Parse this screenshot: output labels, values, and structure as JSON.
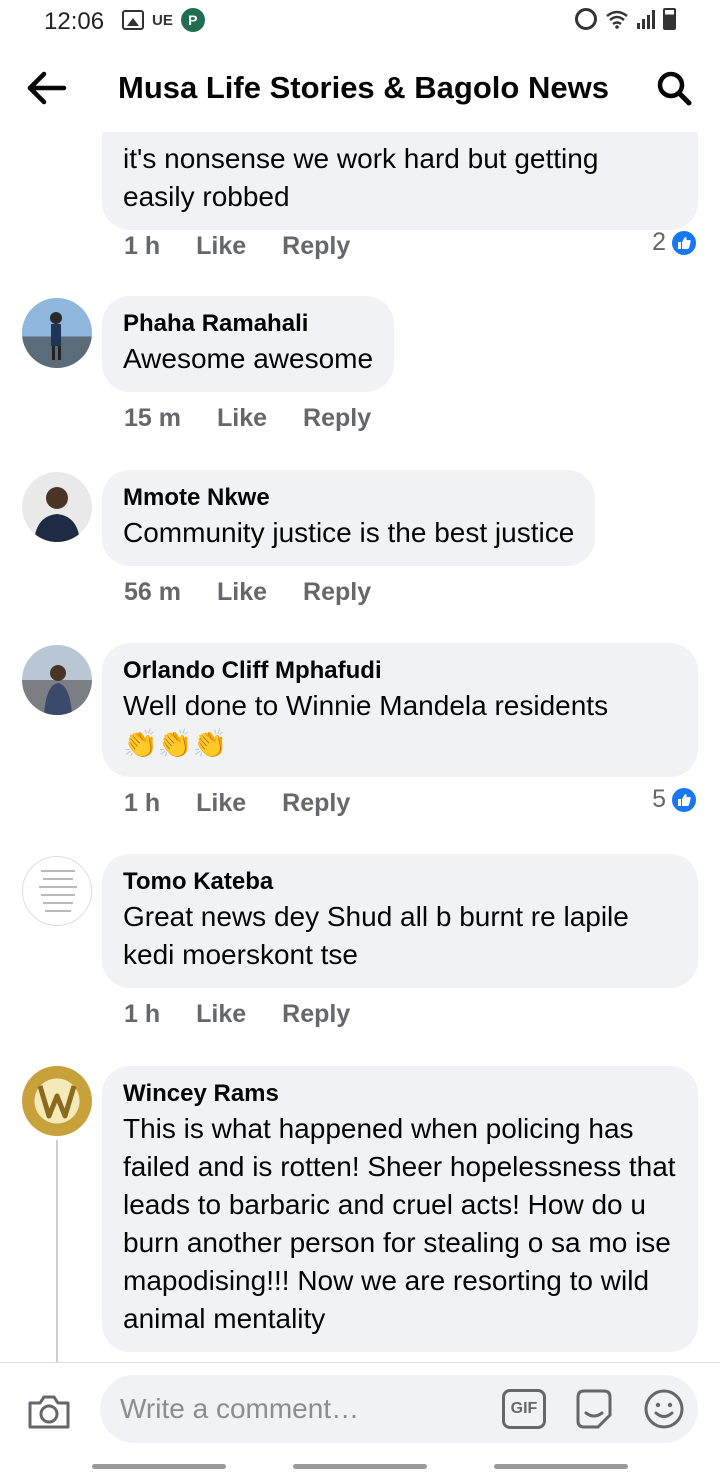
{
  "status_bar": {
    "time": "12:06",
    "carrier": "UE",
    "app_letter": "P"
  },
  "header": {
    "title": "Musa Life Stories & Bagolo News"
  },
  "comments": [
    {
      "author": "",
      "text": "it's nonsense we work hard but getting easily robbed",
      "time": "1 h",
      "like_label": "Like",
      "reply_label": "Reply",
      "reaction_count": "2"
    },
    {
      "author": "Phaha Ramahali",
      "text": "Awesome awesome",
      "time": "15 m",
      "like_label": "Like",
      "reply_label": "Reply",
      "reaction_count": ""
    },
    {
      "author": "Mmote Nkwe",
      "text": "Community justice is the best justice",
      "time": "56 m",
      "like_label": "Like",
      "reply_label": "Reply",
      "reaction_count": ""
    },
    {
      "author": "Orlando Cliff Mphafudi",
      "text": "Well done to Winnie Mandela residents",
      "emoji": "👏👏👏",
      "time": "1 h",
      "like_label": "Like",
      "reply_label": "Reply",
      "reaction_count": "5"
    },
    {
      "author": "Tomo Kateba",
      "text": "Great news dey Shud all b burnt re lapile kedi moerskont tse",
      "time": "1 h",
      "like_label": "Like",
      "reply_label": "Reply",
      "reaction_count": ""
    },
    {
      "author": "Wincey Rams",
      "text": "This is what happened when policing has failed and is rotten! Sheer hopelessness that leads to barbaric and cruel acts! How do u burn another person for stealing o sa mo ise mapodising!!! Now we are resorting to wild animal mentality",
      "time": "",
      "like_label": "",
      "reply_label": "",
      "reaction_count": ""
    }
  ],
  "composer": {
    "placeholder": "Write a comment…",
    "gif_label": "GIF"
  },
  "colors": {
    "accent": "#1877f2",
    "bubble": "#f0f2f5",
    "meta": "#65676b"
  }
}
